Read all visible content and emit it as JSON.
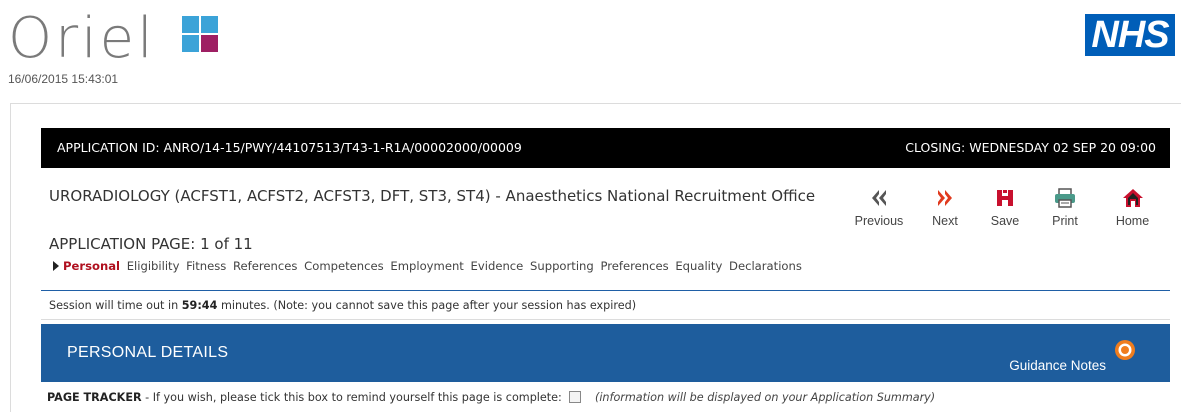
{
  "header": {
    "logo_text": "Oriel",
    "timestamp": "16/06/2015 15:43:01",
    "nhs_logo_text": "NHS"
  },
  "application": {
    "id_text": "APPLICATION ID: ANRO/14-15/PWY/44107513/T43-1-R1A/00002000/00009",
    "closing_text": "CLOSING: WEDNESDAY 02 SEP 20 09:00",
    "post_title": "URORADIOLOGY (ACFST1, ACFST2, ACFST3, DFT, ST3, ST4) - Anaesthetics National Recruitment Office",
    "page_label": "APPLICATION PAGE: 1 of 11"
  },
  "toolbar": {
    "previous": "Previous",
    "next": "Next",
    "save": "Save",
    "print": "Print",
    "home": "Home"
  },
  "steps": [
    "Personal",
    "Eligibility",
    "Fitness",
    "References",
    "Competences",
    "Employment",
    "Evidence",
    "Supporting",
    "Preferences",
    "Equality",
    "Declarations"
  ],
  "active_step": "Personal",
  "session": {
    "prefix": "Session will time out in",
    "time": "59:44",
    "suffix": "minutes. (Note: you cannot save this page after your session has expired)"
  },
  "section": {
    "title": "PERSONAL DETAILS",
    "guidance_label": "Guidance Notes"
  },
  "tracker": {
    "label": "PAGE TRACKER",
    "text": "- If you wish, please tick this box to remind yourself this page is complete:",
    "note": "(information will be displayed on your Application Summary)",
    "checked": false
  },
  "colors": {
    "logo_blue": "#3ba3d8",
    "logo_magenta": "#9e1f63",
    "nhs_blue": "#005eb8",
    "section_blue": "#1e5d9d",
    "active_step_red": "#b0101f",
    "nav_red": "#e03a1e",
    "save_red": "#c8102e",
    "guidance_orange": "#f07d1e"
  }
}
